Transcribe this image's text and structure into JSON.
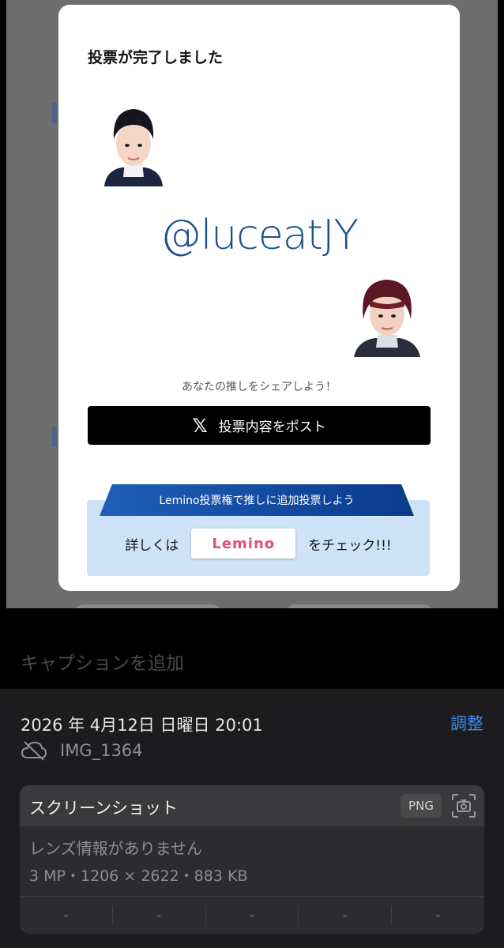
{
  "modal": {
    "title": "投票が完了しました",
    "handle": "@luceatJY",
    "share_prompt": "あなたの推しをシェアしよう！",
    "post_button": "投票内容をポスト",
    "x_glyph": "𝕏",
    "lemino_banner": "Lemino投票権で推しに追加投票しよう",
    "lemino_prefix": "詳しくは",
    "lemino_logo": "Lemino",
    "lemino_suffix": "をチェック!!!"
  },
  "caption_placeholder": "キャプションを追加",
  "info": {
    "datetime": "2026 年 4月12日 日曜日 20:01",
    "adjust_label": "調整",
    "filename": "IMG_1364",
    "card_title": "スクリーンショット",
    "format_badge": "PNG",
    "lens_info": "レンズ情報がありません",
    "meta": "3 MP・1206 × 2622・883 KB",
    "exif": [
      "-",
      "-",
      "-",
      "-",
      "-"
    ]
  },
  "colors": {
    "handle": "#1b4f8c",
    "link_blue": "#3b8ef0",
    "lemino_pink": "#e0517a",
    "banner_blue": "#1f5fb8"
  },
  "icons": [
    "x-logo-icon",
    "cloud-off-icon",
    "camera-viewfinder-icon"
  ]
}
